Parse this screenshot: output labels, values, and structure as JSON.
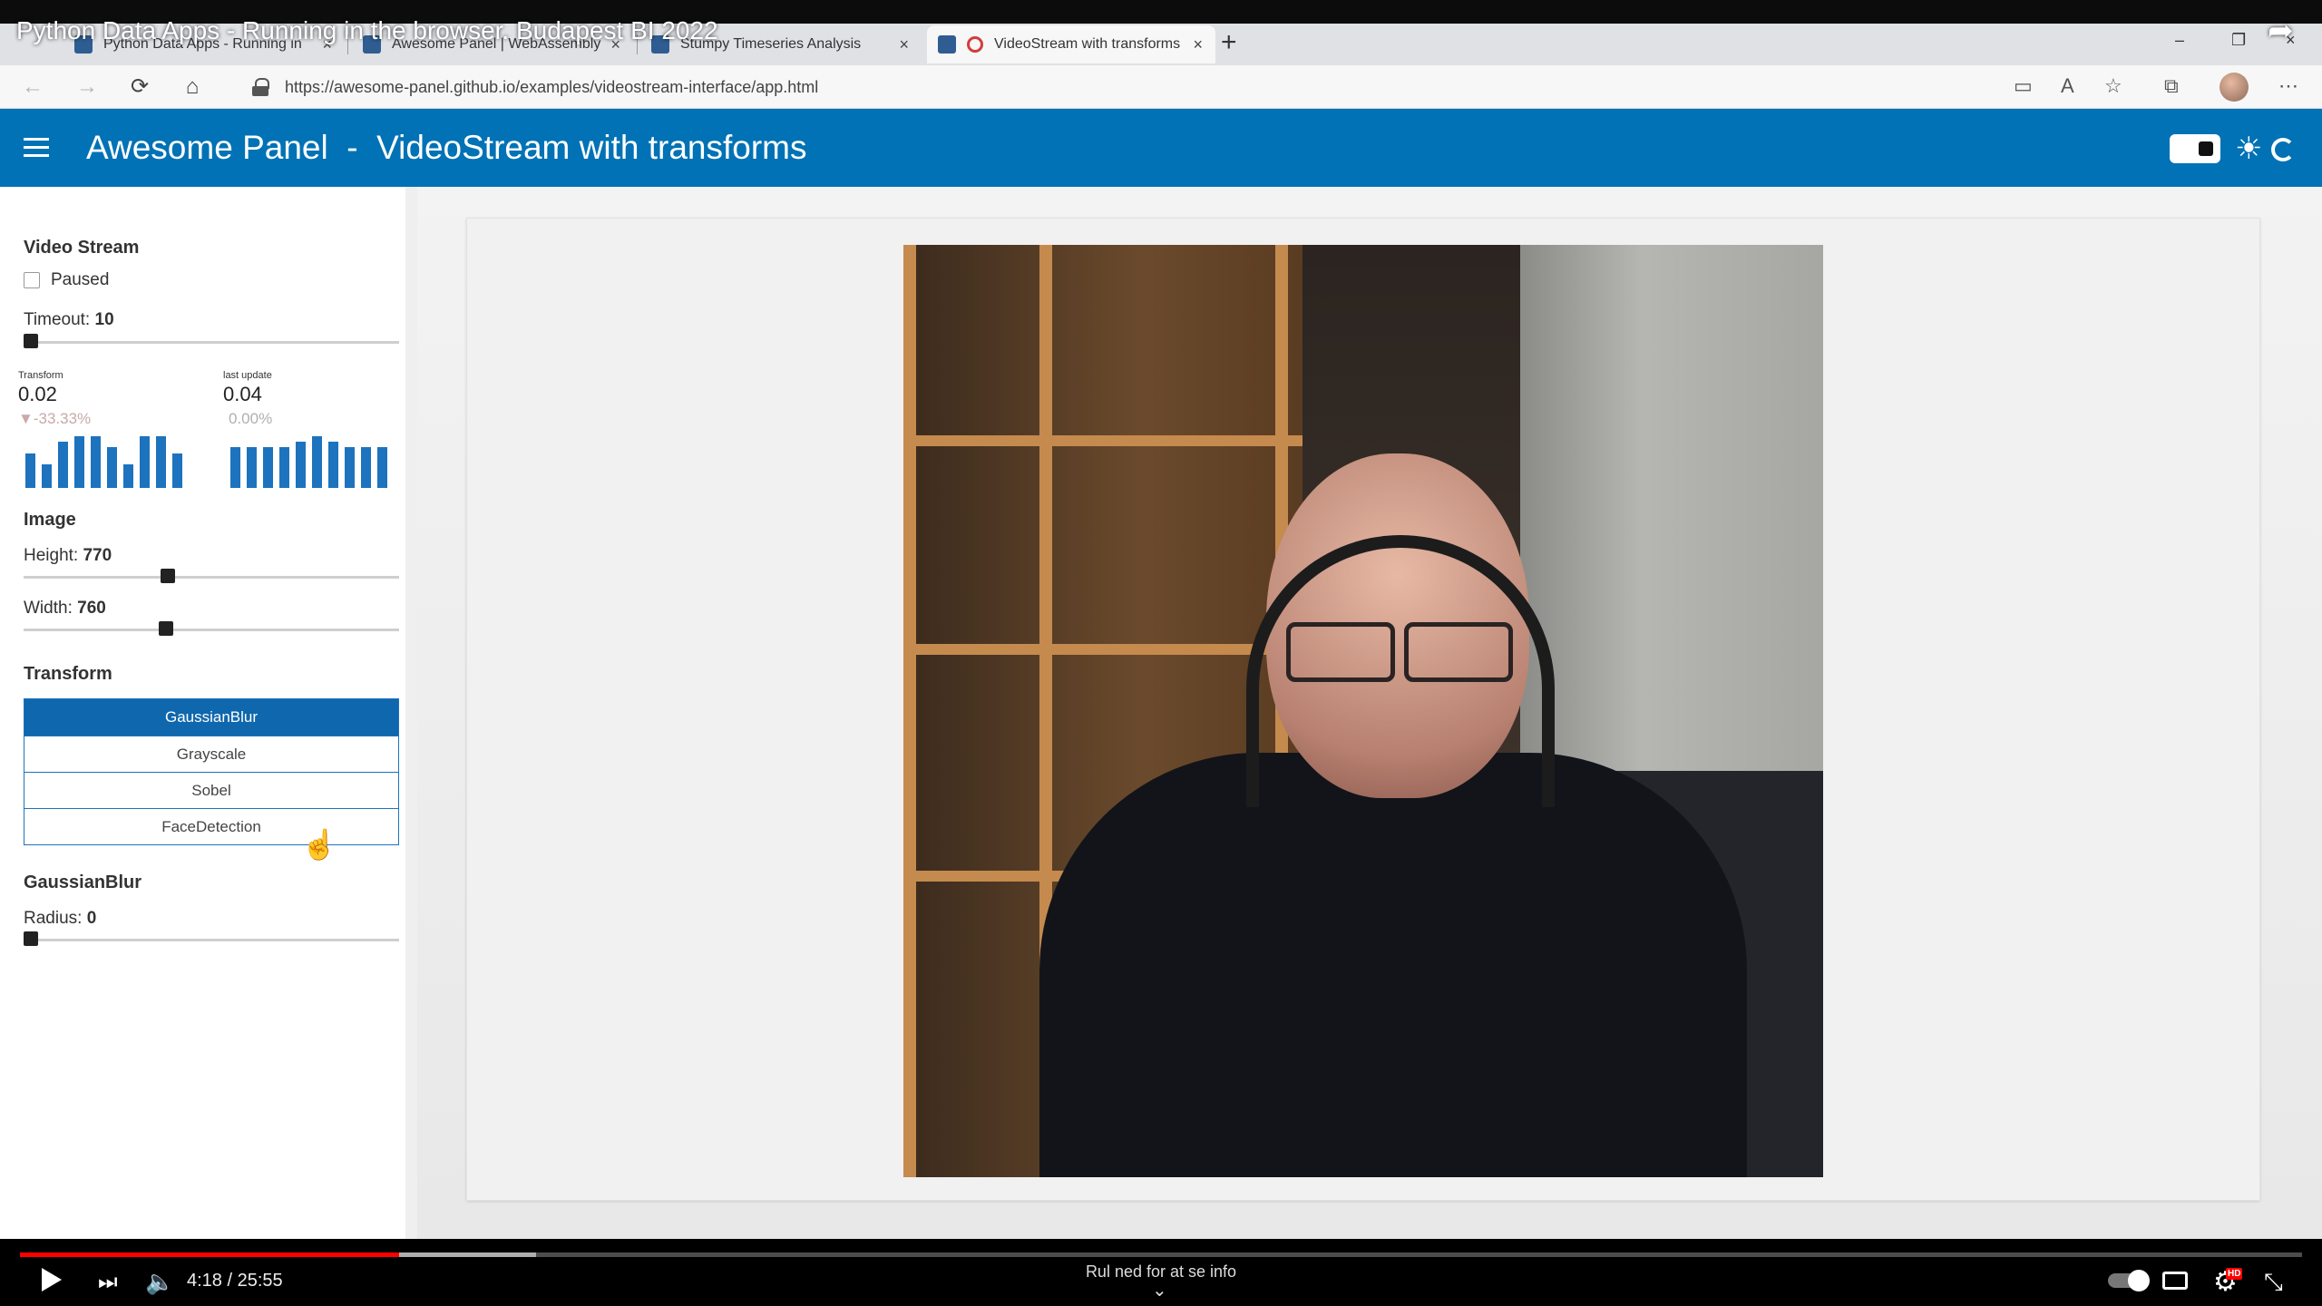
{
  "video_overlay": {
    "title": "Python Data Apps - Running in the browser. Budapest BI 2022",
    "share_icon": "share-icon"
  },
  "browser": {
    "tabs": [
      {
        "label": "Python Data Apps - Running in",
        "icon": "awesome-panel-icon"
      },
      {
        "label": "Awesome Panel | WebAssembly",
        "icon": "awesome-panel-icon"
      },
      {
        "label": "Stumpy Timeseries Analysis",
        "icon": "awesome-panel-icon"
      },
      {
        "label": "VideoStream with transforms",
        "icon": "awesome-panel-icon",
        "active": true,
        "recording": true
      }
    ],
    "close_glyph": "×",
    "new_tab_glyph": "+",
    "window_controls": [
      "–",
      "❐",
      "×"
    ],
    "url": "https://awesome-panel.github.io/examples/videostream-interface/app.html",
    "nav": {
      "back": "←",
      "forward": "→",
      "reload": "⟳",
      "home": "⌂"
    },
    "toolbar_icons": [
      "video-icon",
      "read-aloud-icon",
      "favorite-icon",
      "collections-icon",
      "profile-avatar",
      "more-icon"
    ]
  },
  "app": {
    "brand": "Awesome Panel",
    "separator": "-",
    "page_title": "VideoStream with transforms",
    "accent_color": "#0072b5"
  },
  "sidebar": {
    "video_stream": {
      "title": "Video Stream",
      "paused_label": "Paused",
      "paused": false,
      "timeout_label": "Timeout:",
      "timeout_value": "10",
      "timeout_fraction": 0.0
    },
    "indicators": [
      {
        "title": "Transform",
        "value": "0.02",
        "change": "▼-33.33%",
        "bars": [
          0.62,
          0.42,
          0.82,
          0.92,
          0.92,
          0.72,
          0.42,
          0.92,
          0.92,
          0.62
        ]
      },
      {
        "title": "last update",
        "value": "0.04",
        "change": "0.00%",
        "bars": [
          0.72,
          0.72,
          0.72,
          0.72,
          0.82,
          0.92,
          0.82,
          0.72,
          0.72,
          0.72
        ]
      }
    ],
    "image": {
      "title": "Image",
      "height_label": "Height:",
      "height_value": "770",
      "height_fraction": 0.38,
      "width_label": "Width:",
      "width_value": "760",
      "width_fraction": 0.375
    },
    "transform": {
      "title": "Transform",
      "options": [
        "GaussianBlur",
        "Grayscale",
        "Sobel",
        "FaceDetection"
      ],
      "selected": "GaussianBlur"
    },
    "gaussian_blur": {
      "title": "GaussianBlur",
      "radius_label": "Radius:",
      "radius_value": "0",
      "radius_fraction": 0.0
    }
  },
  "player": {
    "time": "4:18 / 25:55",
    "played_fraction": 0.166,
    "buffered_fraction": 0.12,
    "hint": "Rul ned for at se info",
    "hd_badge": "HD"
  }
}
